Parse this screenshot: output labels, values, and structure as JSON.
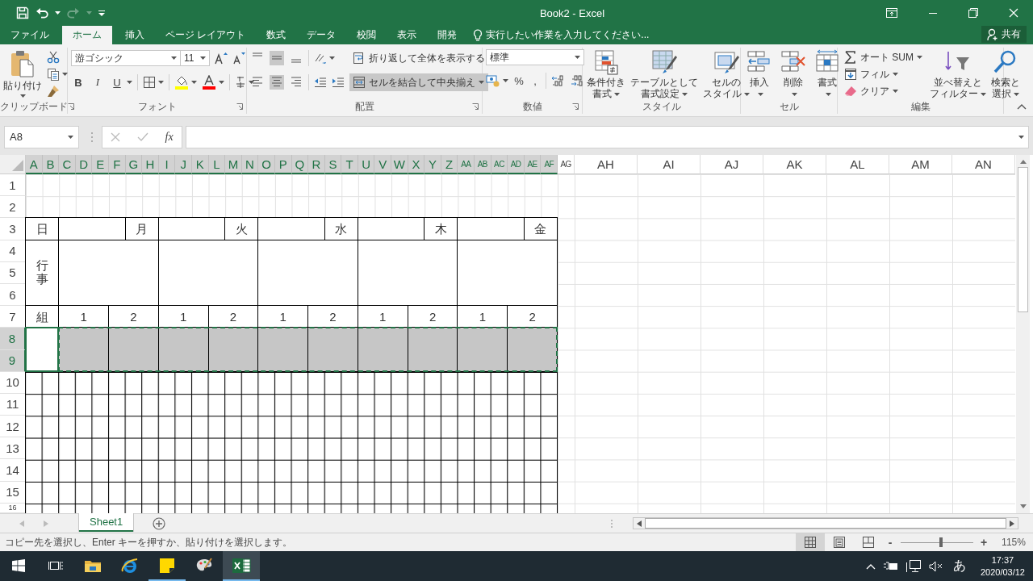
{
  "title_bar": {
    "title": "Book2 - Excel"
  },
  "tabs": [
    {
      "label": "ファイル",
      "selected": false
    },
    {
      "label": "ホーム",
      "selected": true
    },
    {
      "label": "挿入",
      "selected": false
    },
    {
      "label": "ページ レイアウト",
      "selected": false
    },
    {
      "label": "数式",
      "selected": false
    },
    {
      "label": "データ",
      "selected": false
    },
    {
      "label": "校閲",
      "selected": false
    },
    {
      "label": "表示",
      "selected": false
    },
    {
      "label": "開発",
      "selected": false
    }
  ],
  "tell_me": "実行したい作業を入力してください...",
  "share": "共有",
  "ribbon": {
    "clipboard": {
      "label": "クリップボード",
      "paste": "貼り付け"
    },
    "font": {
      "label": "フォント",
      "font_name": "游ゴシック",
      "font_size": "11",
      "bold": "B",
      "italic": "I",
      "underline": "U"
    },
    "alignment": {
      "label": "配置",
      "vertical": [
        {
          "selected": false
        },
        {
          "selected": true
        },
        {
          "selected": false
        }
      ],
      "horizontal": [
        {
          "selected": false
        },
        {
          "selected": true
        },
        {
          "selected": false
        }
      ],
      "wrap_text": {
        "label": "折り返して全体を表示する",
        "selected": false
      },
      "merge_center": {
        "label": "セルを結合して中央揃え",
        "selected": true
      }
    },
    "number": {
      "label": "数値",
      "format": "標準",
      "percent": "%",
      "comma": ","
    },
    "styles": {
      "label": "スタイル",
      "buttons": [
        {
          "kind": "conditional",
          "lines": [
            "条件付き",
            "書式"
          ]
        },
        {
          "kind": "table",
          "lines": [
            "テーブルとして",
            "書式設定"
          ]
        },
        {
          "kind": "cellstyle",
          "lines": [
            "セルの",
            "スタイル"
          ]
        }
      ]
    },
    "cells": {
      "label": "セル",
      "buttons": [
        {
          "kind": "insert",
          "label": "挿入"
        },
        {
          "kind": "delete",
          "label": "削除"
        },
        {
          "kind": "format",
          "label": "書式"
        }
      ]
    },
    "editing": {
      "label": "編集",
      "small": [
        {
          "kind": "autosum",
          "label": "オート SUM"
        },
        {
          "kind": "fill",
          "label": "フィル"
        },
        {
          "kind": "clear",
          "label": "クリア"
        }
      ],
      "big": [
        {
          "kind": "sort",
          "lines": [
            "並べ替えと",
            "フィルター"
          ]
        },
        {
          "kind": "find",
          "lines": [
            "検索と",
            "選択"
          ]
        }
      ]
    }
  },
  "formula_bar": {
    "name_box": "A8",
    "function": "fx"
  },
  "sheet": {
    "columns": [
      {
        "label": "A",
        "selected": true
      },
      {
        "label": "B",
        "selected": true
      },
      {
        "label": "C",
        "selected": true
      },
      {
        "label": "D",
        "selected": true
      },
      {
        "label": "E",
        "selected": true
      },
      {
        "label": "F",
        "selected": true
      },
      {
        "label": "G",
        "selected": true
      },
      {
        "label": "H",
        "selected": true
      },
      {
        "label": "I",
        "selected": true
      },
      {
        "label": "J",
        "selected": true
      },
      {
        "label": "K",
        "selected": true
      },
      {
        "label": "L",
        "selected": true
      },
      {
        "label": "M",
        "selected": true
      },
      {
        "label": "N",
        "selected": true
      },
      {
        "label": "O",
        "selected": true
      },
      {
        "label": "P",
        "selected": true
      },
      {
        "label": "Q",
        "selected": true
      },
      {
        "label": "R",
        "selected": true
      },
      {
        "label": "S",
        "selected": true
      },
      {
        "label": "T",
        "selected": true
      },
      {
        "label": "U",
        "selected": true
      },
      {
        "label": "V",
        "selected": true
      },
      {
        "label": "W",
        "selected": true
      },
      {
        "label": "X",
        "selected": true
      },
      {
        "label": "Y",
        "selected": true
      },
      {
        "label": "Z",
        "selected": true
      },
      {
        "label": "AA",
        "selected": true
      },
      {
        "label": "AB",
        "selected": true
      },
      {
        "label": "AC",
        "selected": true
      },
      {
        "label": "AD",
        "selected": true
      },
      {
        "label": "AE",
        "selected": true
      },
      {
        "label": "AF",
        "selected": true
      },
      {
        "label": "AG",
        "selected": false
      },
      {
        "label": "AH",
        "selected": false
      },
      {
        "label": "AI",
        "selected": false
      },
      {
        "label": "AJ",
        "selected": false
      },
      {
        "label": "AK",
        "selected": false
      },
      {
        "label": "AL",
        "selected": false
      },
      {
        "label": "AM",
        "selected": false
      },
      {
        "label": "AN",
        "selected": false
      }
    ],
    "rows": [
      {
        "label": "1",
        "selected": false
      },
      {
        "label": "2",
        "selected": false
      },
      {
        "label": "3",
        "selected": false
      },
      {
        "label": "4",
        "selected": false
      },
      {
        "label": "5",
        "selected": false
      },
      {
        "label": "6",
        "selected": false
      },
      {
        "label": "7",
        "selected": false
      },
      {
        "label": "8",
        "selected": true
      },
      {
        "label": "9",
        "selected": true
      },
      {
        "label": "10",
        "selected": false
      },
      {
        "label": "11",
        "selected": false
      },
      {
        "label": "12",
        "selected": false
      },
      {
        "label": "13",
        "selected": false
      },
      {
        "label": "14",
        "selected": false
      },
      {
        "label": "15",
        "selected": false
      },
      {
        "label": "16",
        "selected": false
      }
    ],
    "table": {
      "date_label": "日",
      "events_label": "行事",
      "class_label": "組",
      "entry_cell": {
        "active": true
      },
      "copy_marquee": true,
      "days": [
        {
          "label": "月",
          "classes": [
            {
              "label": "1",
              "selected": true
            },
            {
              "label": "2",
              "selected": true
            }
          ]
        },
        {
          "label": "火",
          "classes": [
            {
              "label": "1",
              "selected": true
            },
            {
              "label": "2",
              "selected": true
            }
          ]
        },
        {
          "label": "水",
          "classes": [
            {
              "label": "1",
              "selected": true
            },
            {
              "label": "2",
              "selected": true
            }
          ]
        },
        {
          "label": "木",
          "classes": [
            {
              "label": "1",
              "selected": true
            },
            {
              "label": "2",
              "selected": true
            }
          ]
        },
        {
          "label": "金",
          "classes": [
            {
              "label": "1",
              "selected": true
            },
            {
              "label": "2",
              "selected": true
            }
          ]
        }
      ]
    }
  },
  "sheet_tabs": [
    {
      "label": "Sheet1",
      "selected": true
    }
  ],
  "status_bar": {
    "message": "コピー先を選択し、Enter キーを押すか、貼り付けを選択します。",
    "views": [
      {
        "kind": "normal",
        "selected": true
      },
      {
        "kind": "page_layout",
        "selected": false
      },
      {
        "kind": "page_break",
        "selected": false
      }
    ],
    "zoom_out": "-",
    "zoom_in": "+",
    "zoom": {
      "level": 0.55,
      "reading": "115%"
    }
  },
  "taskbar": {
    "apps": [
      {
        "kind": "start",
        "running": false,
        "active": false
      },
      {
        "kind": "taskview",
        "running": false,
        "active": false
      },
      {
        "kind": "explorer",
        "running": false,
        "active": false
      },
      {
        "kind": "browser",
        "running": false,
        "active": false
      },
      {
        "kind": "sticky",
        "running": true,
        "active": false
      },
      {
        "kind": "paint",
        "running": false,
        "active": false
      },
      {
        "kind": "excel",
        "running": true,
        "active": true
      }
    ],
    "ime": "あ",
    "time": "17:37",
    "date": "2020/03/12"
  }
}
